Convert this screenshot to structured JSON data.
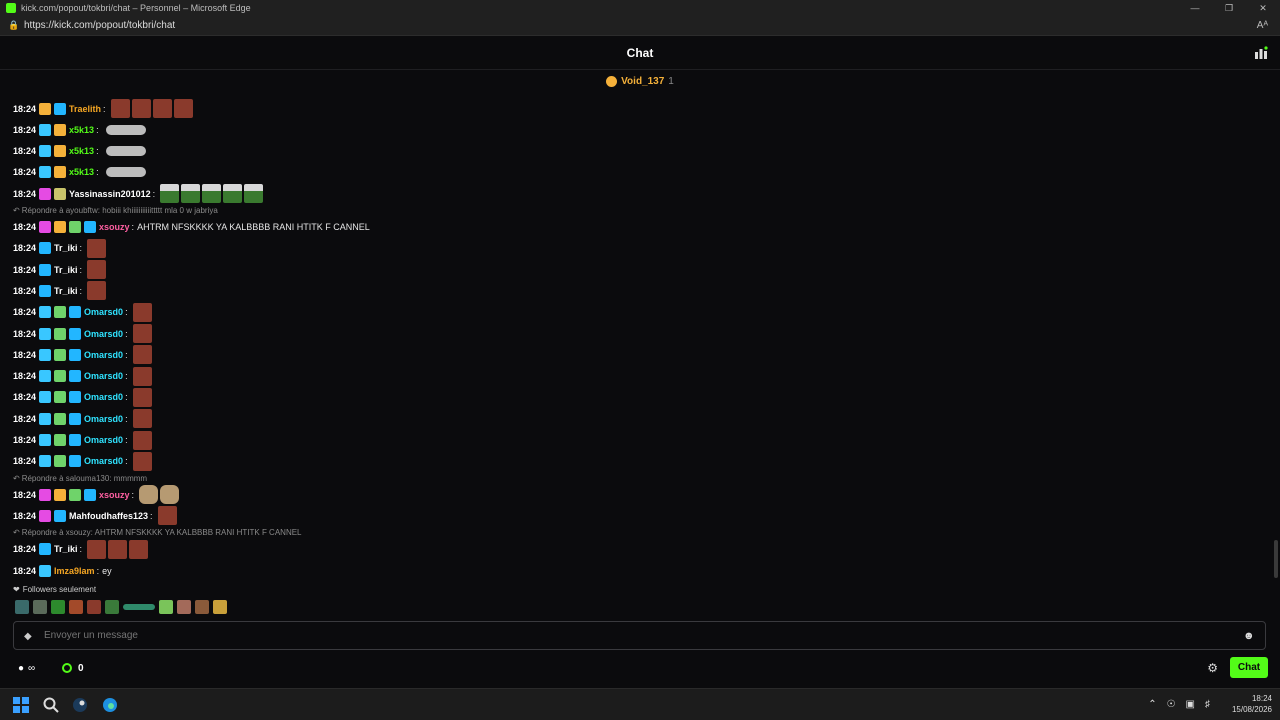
{
  "browser": {
    "window_title": "kick.com/popout/tokbri/chat – Personnel – Microsoft Edge",
    "url": "https://kick.com/popout/tokbri/chat",
    "reader_label": "Aᴬ"
  },
  "header": {
    "title": "Chat"
  },
  "pinned": {
    "user": "Void_137",
    "count": "1"
  },
  "messages": [
    {
      "time": "18:24",
      "user": "Traelith",
      "user_color": "#f5a623",
      "text": "",
      "badges": [
        "crown",
        "og"
      ],
      "emotes": 4,
      "emote_type": "red"
    },
    {
      "time": "18:24",
      "user": "x5k13",
      "user_color": "#53fc18",
      "text": "",
      "badges": [
        "sub",
        "crown"
      ],
      "emotes": 1,
      "emote_type": "wide"
    },
    {
      "time": "18:24",
      "user": "x5k13",
      "user_color": "#53fc18",
      "text": "",
      "badges": [
        "sub",
        "crown"
      ],
      "emotes": 1,
      "emote_type": "wide"
    },
    {
      "time": "18:24",
      "user": "x5k13",
      "user_color": "#53fc18",
      "text": "",
      "badges": [
        "sub",
        "crown"
      ],
      "emotes": 1,
      "emote_type": "wide"
    },
    {
      "time": "18:24",
      "user": "Yassinassin201012",
      "user_color": "#ffffff",
      "text": "",
      "badges": [
        "vip",
        "tw"
      ],
      "emotes": 5,
      "emote_type": "eyes"
    },
    {
      "reply": "Répondre à ayoubftw: hobiii khiiiiiiiiiiittttt mla 0 w jabriya"
    },
    {
      "time": "18:24",
      "user": "xsouzy",
      "user_color": "#ff5fa2",
      "text": "AHTRM NFSKKKK YA KALBBBB RANI HTITK F CANNEL",
      "badges": [
        "vip",
        "crown",
        "gift",
        "og"
      ],
      "emotes": 0,
      "emote_type": ""
    },
    {
      "time": "18:24",
      "user": "Tr_iki",
      "user_color": "#ffffff",
      "text": "",
      "badges": [
        "og"
      ],
      "emotes": 1,
      "emote_type": "red"
    },
    {
      "time": "18:24",
      "user": "Tr_iki",
      "user_color": "#ffffff",
      "text": "",
      "badges": [
        "og"
      ],
      "emotes": 1,
      "emote_type": "red"
    },
    {
      "time": "18:24",
      "user": "Tr_iki",
      "user_color": "#ffffff",
      "text": "",
      "badges": [
        "og"
      ],
      "emotes": 1,
      "emote_type": "red"
    },
    {
      "time": "18:24",
      "user": "Omarsd0",
      "user_color": "#2fe3ff",
      "text": "",
      "badges": [
        "sub",
        "gift",
        "og"
      ],
      "emotes": 1,
      "emote_type": "red"
    },
    {
      "time": "18:24",
      "user": "Omarsd0",
      "user_color": "#2fe3ff",
      "text": "",
      "badges": [
        "sub",
        "gift",
        "og"
      ],
      "emotes": 1,
      "emote_type": "red"
    },
    {
      "time": "18:24",
      "user": "Omarsd0",
      "user_color": "#2fe3ff",
      "text": "",
      "badges": [
        "sub",
        "gift",
        "og"
      ],
      "emotes": 1,
      "emote_type": "red"
    },
    {
      "time": "18:24",
      "user": "Omarsd0",
      "user_color": "#2fe3ff",
      "text": "",
      "badges": [
        "sub",
        "gift",
        "og"
      ],
      "emotes": 1,
      "emote_type": "red"
    },
    {
      "time": "18:24",
      "user": "Omarsd0",
      "user_color": "#2fe3ff",
      "text": "",
      "badges": [
        "sub",
        "gift",
        "og"
      ],
      "emotes": 1,
      "emote_type": "red"
    },
    {
      "time": "18:24",
      "user": "Omarsd0",
      "user_color": "#2fe3ff",
      "text": "",
      "badges": [
        "sub",
        "gift",
        "og"
      ],
      "emotes": 1,
      "emote_type": "red"
    },
    {
      "time": "18:24",
      "user": "Omarsd0",
      "user_color": "#2fe3ff",
      "text": "",
      "badges": [
        "sub",
        "gift",
        "og"
      ],
      "emotes": 1,
      "emote_type": "red"
    },
    {
      "time": "18:24",
      "user": "Omarsd0",
      "user_color": "#2fe3ff",
      "text": "",
      "badges": [
        "sub",
        "gift",
        "og"
      ],
      "emotes": 1,
      "emote_type": "red"
    },
    {
      "reply": "Répondre à salouma130: mmmmm"
    },
    {
      "time": "18:24",
      "user": "xsouzy",
      "user_color": "#ff5fa2",
      "text": "",
      "badges": [
        "vip",
        "crown",
        "gift",
        "og"
      ],
      "emotes": 2,
      "emote_type": "cat"
    },
    {
      "time": "18:24",
      "user": "Mahfoudhaffes123",
      "user_color": "#ffffff",
      "text": "",
      "badges": [
        "vip",
        "og"
      ],
      "emotes": 1,
      "emote_type": "red"
    },
    {
      "reply": "Répondre à xsouzy: AHTRM NFSKKKK YA KALBBBB RANI HTITK F CANNEL"
    },
    {
      "time": "18:24",
      "user": "Tr_iki",
      "user_color": "#ffffff",
      "text": "",
      "badges": [
        "og"
      ],
      "emotes": 3,
      "emote_type": "red"
    },
    {
      "time": "18:24",
      "user": "Imza9lam",
      "user_color": "#f5a623",
      "text": "ey",
      "badges": [
        "sub"
      ],
      "emotes": 0,
      "emote_type": ""
    }
  ],
  "footer": {
    "mode_label": "Followers seulement",
    "input_placeholder": "Envoyer un message",
    "points_value": "∞",
    "kick_count": "0",
    "chat_button": "Chat"
  },
  "taskbar": {
    "time": "18:24",
    "date": "15/08/2026"
  },
  "colors": {
    "accent": "#53fc18",
    "background": "#0b0b0d"
  }
}
